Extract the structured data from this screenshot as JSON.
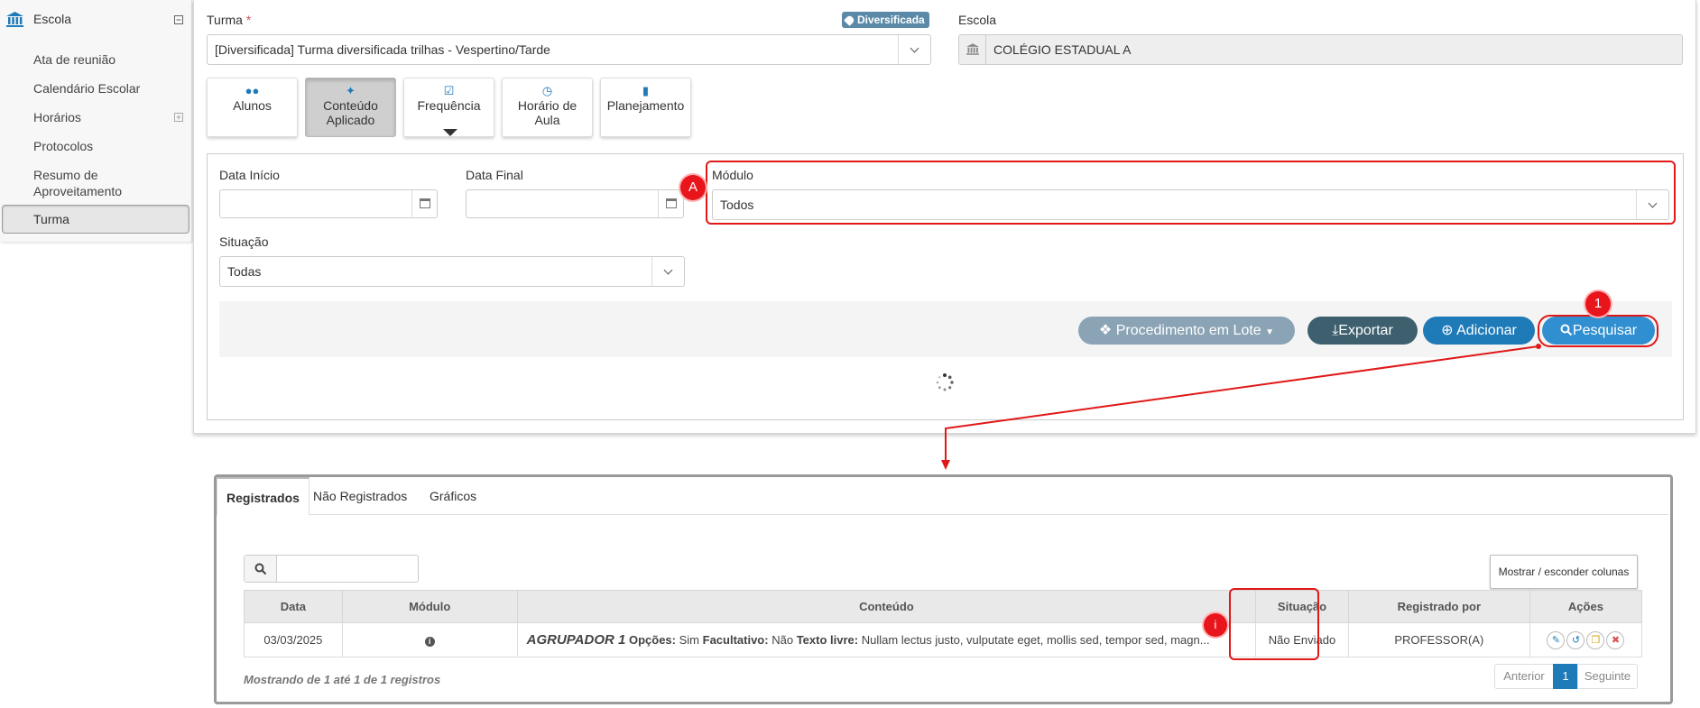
{
  "colors": {
    "accent_blue": "#1f7ab8",
    "dark_teal": "#3e5f6e",
    "lote_btn": "#8aa3b5",
    "red_annotation": "#e01818",
    "pager_active": "#1f7ab8"
  },
  "sidebar": {
    "title": "Escola",
    "icon": "bank-icon",
    "collapse_icon": "minus-square-icon",
    "items": [
      {
        "label": "Ata de reunião"
      },
      {
        "label": "Calendário Escolar"
      },
      {
        "label": "Horários",
        "expand_icon": "plus-square-icon"
      },
      {
        "label": "Protocolos"
      },
      {
        "label": "Resumo de Aproveitamento"
      },
      {
        "label": "Turma",
        "selected": true
      }
    ]
  },
  "form": {
    "turma_label": "Turma",
    "required_mark": "*",
    "badge": "Diversificada",
    "turma_value": "[Diversificada]  Turma diversificada trilhas - Vespertino/Tarde",
    "escola_label": "Escola",
    "escola_value": "COLÉGIO ESTADUAL A"
  },
  "tiles": [
    {
      "line1": "Alunos",
      "line2": "",
      "icon": "users-icon"
    },
    {
      "line1": "Conteúdo",
      "line2": "Aplicado",
      "icon": "magic-wand-icon",
      "active": true
    },
    {
      "line1": "Frequência",
      "line2": "",
      "icon": "checkbox-icon"
    },
    {
      "line1": "Horário de",
      "line2": "Aula",
      "icon": "clock-icon"
    },
    {
      "line1": "Planejamento",
      "line2": "",
      "icon": "book-icon"
    }
  ],
  "filters": {
    "data_inicio_label": "Data Início",
    "data_final_label": "Data Final",
    "modulo_label": "Módulo",
    "modulo_value": "Todos",
    "situacao_label": "Situação",
    "situacao_value": "Todas"
  },
  "actions": {
    "lote": "Procedimento em Lote",
    "exportar": "Exportar",
    "adicionar": "Adicionar",
    "pesquisar": "Pesquisar"
  },
  "annotations": {
    "a": "A",
    "one": "1",
    "i": "i"
  },
  "results": {
    "tabs": [
      "Registrados",
      "Não Registrados",
      "Gráficos"
    ],
    "toggle_columns": "Mostrar / esconder colunas",
    "columns": [
      "Data",
      "Módulo",
      "Conteúdo",
      "Situação",
      "Registrado por",
      "Ações"
    ],
    "rows": [
      {
        "data": "03/03/2025",
        "conteudo_group": "AGRUPADOR 1",
        "conteudo_opcoes_label": "Opções:",
        "conteudo_opcoes": "Sim",
        "conteudo_facultativo_label": "Facultativo:",
        "conteudo_facultativo": "Não",
        "conteudo_texto_label": "Texto livre:",
        "conteudo_texto": "Nullam lectus justo, vulputate eget, mollis sed, tempor sed, magn...",
        "situacao": "Não Enviado",
        "registrado_por": "PROFESSOR(A)"
      }
    ],
    "footer": "Mostrando de 1 até 1 de 1 registros",
    "pager": {
      "prev": "Anterior",
      "current": "1",
      "next": "Seguinte"
    }
  }
}
